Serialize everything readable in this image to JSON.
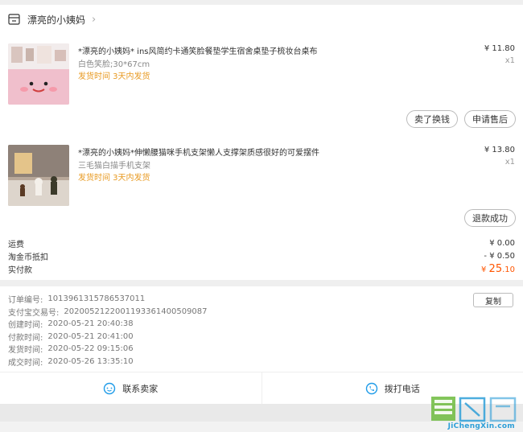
{
  "shop": {
    "name": "漂亮的小姨妈",
    "icon": "shop-icon",
    "chevron": "chevron-right-icon"
  },
  "items": [
    {
      "title": "*漂亮的小姨妈* ins风简约卡通笑脸餐垫学生宿舍桌垫子梳妆台桌布",
      "sku": "白色笑脸;30*67cm",
      "shipping": "发货时间 3天内发货",
      "price": "¥ 11.80",
      "qty": "x1",
      "buttons": [
        "卖了换钱",
        "申请售后"
      ]
    },
    {
      "title": "*漂亮的小姨妈*伸懒腰猫咪手机支架懒人支撑架质感很好的可爱摆件",
      "sku": "三毛猫白描手机支架",
      "shipping": "发货时间 3天内发货",
      "price": "¥ 13.80",
      "qty": "x1",
      "buttons": [
        "退款成功"
      ]
    }
  ],
  "summary": {
    "shipping_label": "运费",
    "shipping_value": "¥ 0.00",
    "coin_label": "淘金币抵扣",
    "coin_value": "- ¥ 0.50",
    "paid_label": "实付款",
    "paid_currency": "¥",
    "paid_int": "25",
    "paid_dec": ".10"
  },
  "order_info": {
    "copy_label": "复制",
    "lines": [
      {
        "label": "订单编号:",
        "value": "1013961315786537011"
      },
      {
        "label": "支付宝交易号:",
        "value": "2020052122001193361400509087"
      },
      {
        "label": "创建时间:",
        "value": "2020-05-21 20:40:38"
      },
      {
        "label": "付款时间:",
        "value": "2020-05-21 20:41:00"
      },
      {
        "label": "发货时间:",
        "value": "2020-05-22 09:15:06"
      },
      {
        "label": "成交时间:",
        "value": "2020-05-26 13:35:10"
      }
    ]
  },
  "actions": [
    {
      "label": "联系卖家",
      "icon": "chat-icon"
    },
    {
      "label": "拨打电话",
      "icon": "phone-icon"
    }
  ],
  "watermark": {
    "url": "JiChengXin.com"
  },
  "colors": {
    "accent": "#ff5500",
    "shipping": "#e89a22",
    "link_blue": "#2e9fd8"
  }
}
